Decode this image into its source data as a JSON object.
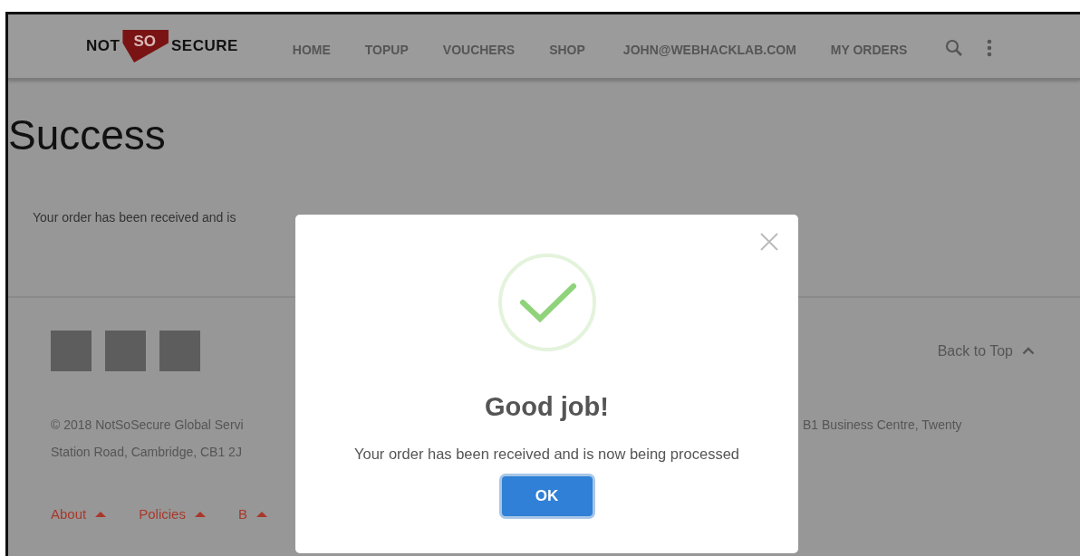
{
  "logo": {
    "left": "NOT",
    "middle": "SO",
    "right": "SECURE"
  },
  "nav": {
    "items": [
      {
        "label": "HOME"
      },
      {
        "label": "TOPUP"
      },
      {
        "label": "VOUCHERS"
      },
      {
        "label": "SHOP"
      },
      {
        "label": "JOHN@WEBHACKLAB.COM"
      },
      {
        "label": "MY ORDERS"
      }
    ]
  },
  "page": {
    "title": "Success",
    "message": "Your order has been received and is"
  },
  "footer": {
    "social_icons": [
      {
        "kind": "square"
      },
      {
        "kind": "square"
      },
      {
        "kind": "square"
      }
    ],
    "back_to_top": "Back to Top",
    "copyright_left": [
      "© 2018 NotSoSecure Global Servi",
      "Station Road, Cambridge, CB1 2J"
    ],
    "copyright_right": "B1 Business Centre, Twenty",
    "links": [
      {
        "label": "About",
        "expanded": false
      },
      {
        "label": "Policies",
        "expanded": false
      },
      {
        "label": "B",
        "expanded": false
      }
    ]
  },
  "dialog": {
    "title": "Good job!",
    "message": "Your order has been received and is now being processed",
    "button": "OK"
  }
}
